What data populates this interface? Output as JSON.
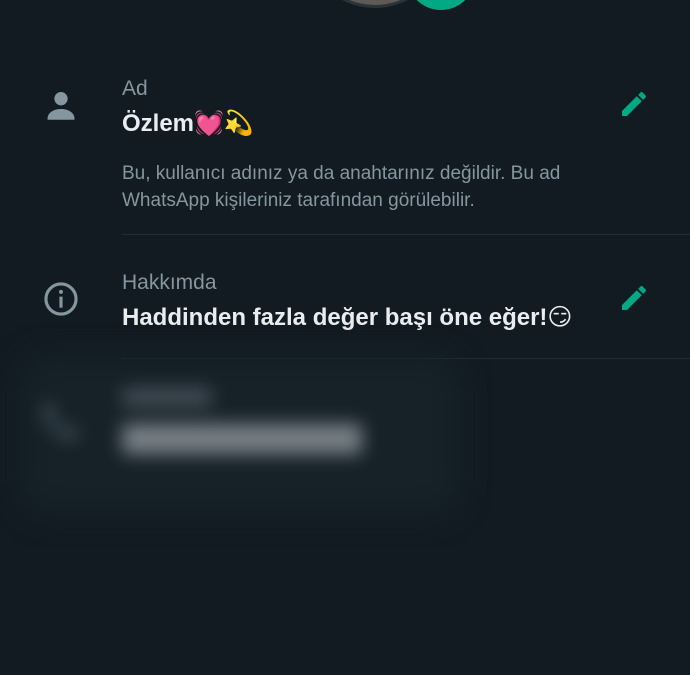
{
  "profile": {
    "name_row": {
      "label": "Ad",
      "value": "Özlem💓💫",
      "description": "Bu, kullanıcı adınız ya da anahtarınız değildir. Bu ad WhatsApp kişileriniz tarafından görülebilir.",
      "icon": "person-icon",
      "edit_icon": "pencil-icon"
    },
    "about_row": {
      "label": "Hakkımda",
      "value": "Haddinden fazla değer başı öne eğer!😏",
      "icon": "info-icon",
      "edit_icon": "pencil-icon"
    },
    "phone_row": {
      "icon": "phone-icon",
      "blurred": true
    }
  },
  "colors": {
    "background": "#111b21",
    "accent": "#00a884",
    "secondary_text": "#8696a0",
    "primary_text": "#e9edef",
    "divider": "#222d34"
  }
}
